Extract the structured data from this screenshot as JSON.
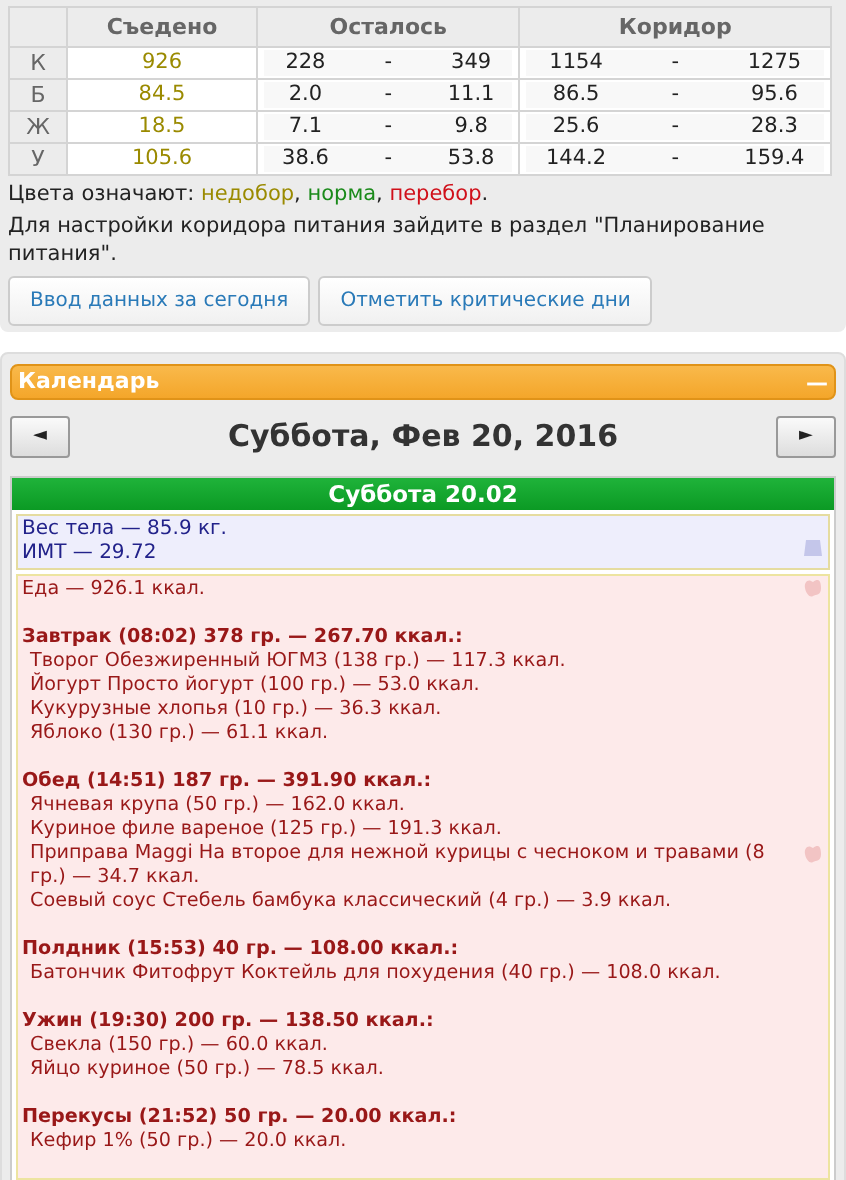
{
  "nutrition_table": {
    "columns": [
      "Съедено",
      "Осталось",
      "Коридор"
    ],
    "rows": [
      {
        "label": "К",
        "eaten": "926",
        "color": "#9a8a00",
        "left_min": "228",
        "left_max": "349",
        "range_min": "1154",
        "range_max": "1275"
      },
      {
        "label": "Б",
        "eaten": "84.5",
        "color": "#9a8a00",
        "left_min": "2.0",
        "left_max": "11.1",
        "range_min": "86.5",
        "range_max": "95.6"
      },
      {
        "label": "Ж",
        "eaten": "18.5",
        "color": "#9a8a00",
        "left_min": "7.1",
        "left_max": "9.8",
        "range_min": "25.6",
        "range_max": "28.3"
      },
      {
        "label": "У",
        "eaten": "105.6",
        "color": "#9a8a00",
        "left_min": "38.6",
        "left_max": "53.8",
        "range_min": "144.2",
        "range_max": "159.4"
      }
    ],
    "separator": "-"
  },
  "legend": {
    "label": "Цвета означают:",
    "items": [
      {
        "text": "недобор",
        "color": "#9a8a00"
      },
      {
        "text": "норма",
        "color": "#1a8a1a"
      },
      {
        "text": "перебор",
        "color": "#d0101a"
      }
    ],
    "separator": ", ",
    "end": "."
  },
  "hint": "Для настройки коридора питания зайдите в раздел \"Планирование питания\".",
  "buttons": [
    "Ввод данных за сегодня",
    "Отметить критические дни"
  ],
  "calendar": {
    "title": "Календарь",
    "collapse": "—",
    "prev": "◄",
    "next": "►",
    "date": "Суббота, Фев 20, 2016",
    "day_header": "Суббота 20.02",
    "body": [
      "Вес тела — 85.9 кг.",
      "ИМТ — 29.72"
    ],
    "food_total": "Еда — 926.1 ккал.",
    "meals": [
      {
        "title": "Завтрак (08:02) 378 гр. — 267.70 ккал.:",
        "items": [
          "Творог Обезжиренный ЮГМЗ (138 гр.) — 117.3 ккал.",
          "Йогурт Просто йогурт (100 гр.) — 53.0 ккал.",
          "Кукурузные хлопья (10 гр.) — 36.3 ккал.",
          "Яблоко (130 гр.) — 61.1 ккал."
        ]
      },
      {
        "title": "Обед (14:51) 187 гр. — 391.90 ккал.:",
        "items": [
          "Ячневая крупа (50 гр.) — 162.0 ккал.",
          "Куриное филе вареное (125 гр.) — 191.3 ккал.",
          "Приправа Maggi На второе для нежной курицы с чесноком и травами (8 гр.) — 34.7 ккал.",
          "Соевый соус Стебель бамбука классический (4 гр.) — 3.9 ккал."
        ]
      },
      {
        "title": "Полдник (15:53) 40 гр. — 108.00 ккал.:",
        "items": [
          "Батончик Фитофрут Коктейль для похудения (40 гр.) — 108.0 ккал."
        ]
      },
      {
        "title": "Ужин (19:30) 200 гр. — 138.50 ккал.:",
        "items": [
          "Свекла (150 гр.) — 60.0 ккал.",
          "Яйцо куриное (50 гр.) — 78.5 ккал."
        ]
      },
      {
        "title": "Перекусы (21:52) 50 гр. — 20.00 ккал.:",
        "items": [
          "Кефир 1% (50 гр.) — 20.0 ккал."
        ]
      }
    ]
  }
}
